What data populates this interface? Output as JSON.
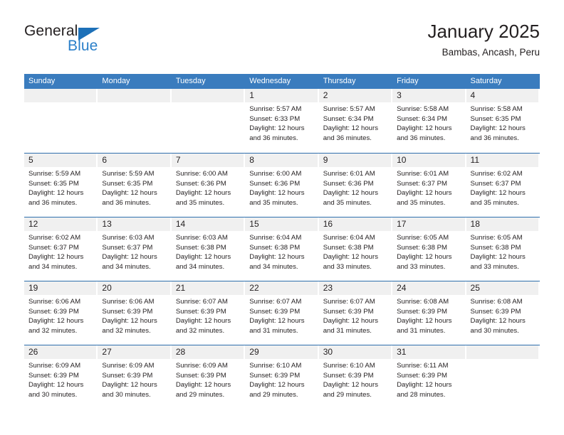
{
  "brand": {
    "name_part1": "General",
    "name_part2": "Blue",
    "triangle_color": "#1d70b8",
    "blue_color": "#2a7fc9"
  },
  "header": {
    "title": "January 2025",
    "subtitle": "Bambas, Ancash, Peru"
  },
  "theme": {
    "header_bar_color": "#3a7cbe",
    "week_divider_color": "#2f6fad",
    "day_number_band_color": "#f0f0f0",
    "text_color": "#231f20"
  },
  "calendar": {
    "weekdays": [
      "Sunday",
      "Monday",
      "Tuesday",
      "Wednesday",
      "Thursday",
      "Friday",
      "Saturday"
    ],
    "weeks": [
      [
        {
          "day": "",
          "lines": []
        },
        {
          "day": "",
          "lines": []
        },
        {
          "day": "",
          "lines": []
        },
        {
          "day": "1",
          "lines": [
            "Sunrise: 5:57 AM",
            "Sunset: 6:33 PM",
            "Daylight: 12 hours",
            "and 36 minutes."
          ]
        },
        {
          "day": "2",
          "lines": [
            "Sunrise: 5:57 AM",
            "Sunset: 6:34 PM",
            "Daylight: 12 hours",
            "and 36 minutes."
          ]
        },
        {
          "day": "3",
          "lines": [
            "Sunrise: 5:58 AM",
            "Sunset: 6:34 PM",
            "Daylight: 12 hours",
            "and 36 minutes."
          ]
        },
        {
          "day": "4",
          "lines": [
            "Sunrise: 5:58 AM",
            "Sunset: 6:35 PM",
            "Daylight: 12 hours",
            "and 36 minutes."
          ]
        }
      ],
      [
        {
          "day": "5",
          "lines": [
            "Sunrise: 5:59 AM",
            "Sunset: 6:35 PM",
            "Daylight: 12 hours",
            "and 36 minutes."
          ]
        },
        {
          "day": "6",
          "lines": [
            "Sunrise: 5:59 AM",
            "Sunset: 6:35 PM",
            "Daylight: 12 hours",
            "and 36 minutes."
          ]
        },
        {
          "day": "7",
          "lines": [
            "Sunrise: 6:00 AM",
            "Sunset: 6:36 PM",
            "Daylight: 12 hours",
            "and 35 minutes."
          ]
        },
        {
          "day": "8",
          "lines": [
            "Sunrise: 6:00 AM",
            "Sunset: 6:36 PM",
            "Daylight: 12 hours",
            "and 35 minutes."
          ]
        },
        {
          "day": "9",
          "lines": [
            "Sunrise: 6:01 AM",
            "Sunset: 6:36 PM",
            "Daylight: 12 hours",
            "and 35 minutes."
          ]
        },
        {
          "day": "10",
          "lines": [
            "Sunrise: 6:01 AM",
            "Sunset: 6:37 PM",
            "Daylight: 12 hours",
            "and 35 minutes."
          ]
        },
        {
          "day": "11",
          "lines": [
            "Sunrise: 6:02 AM",
            "Sunset: 6:37 PM",
            "Daylight: 12 hours",
            "and 35 minutes."
          ]
        }
      ],
      [
        {
          "day": "12",
          "lines": [
            "Sunrise: 6:02 AM",
            "Sunset: 6:37 PM",
            "Daylight: 12 hours",
            "and 34 minutes."
          ]
        },
        {
          "day": "13",
          "lines": [
            "Sunrise: 6:03 AM",
            "Sunset: 6:37 PM",
            "Daylight: 12 hours",
            "and 34 minutes."
          ]
        },
        {
          "day": "14",
          "lines": [
            "Sunrise: 6:03 AM",
            "Sunset: 6:38 PM",
            "Daylight: 12 hours",
            "and 34 minutes."
          ]
        },
        {
          "day": "15",
          "lines": [
            "Sunrise: 6:04 AM",
            "Sunset: 6:38 PM",
            "Daylight: 12 hours",
            "and 34 minutes."
          ]
        },
        {
          "day": "16",
          "lines": [
            "Sunrise: 6:04 AM",
            "Sunset: 6:38 PM",
            "Daylight: 12 hours",
            "and 33 minutes."
          ]
        },
        {
          "day": "17",
          "lines": [
            "Sunrise: 6:05 AM",
            "Sunset: 6:38 PM",
            "Daylight: 12 hours",
            "and 33 minutes."
          ]
        },
        {
          "day": "18",
          "lines": [
            "Sunrise: 6:05 AM",
            "Sunset: 6:38 PM",
            "Daylight: 12 hours",
            "and 33 minutes."
          ]
        }
      ],
      [
        {
          "day": "19",
          "lines": [
            "Sunrise: 6:06 AM",
            "Sunset: 6:39 PM",
            "Daylight: 12 hours",
            "and 32 minutes."
          ]
        },
        {
          "day": "20",
          "lines": [
            "Sunrise: 6:06 AM",
            "Sunset: 6:39 PM",
            "Daylight: 12 hours",
            "and 32 minutes."
          ]
        },
        {
          "day": "21",
          "lines": [
            "Sunrise: 6:07 AM",
            "Sunset: 6:39 PM",
            "Daylight: 12 hours",
            "and 32 minutes."
          ]
        },
        {
          "day": "22",
          "lines": [
            "Sunrise: 6:07 AM",
            "Sunset: 6:39 PM",
            "Daylight: 12 hours",
            "and 31 minutes."
          ]
        },
        {
          "day": "23",
          "lines": [
            "Sunrise: 6:07 AM",
            "Sunset: 6:39 PM",
            "Daylight: 12 hours",
            "and 31 minutes."
          ]
        },
        {
          "day": "24",
          "lines": [
            "Sunrise: 6:08 AM",
            "Sunset: 6:39 PM",
            "Daylight: 12 hours",
            "and 31 minutes."
          ]
        },
        {
          "day": "25",
          "lines": [
            "Sunrise: 6:08 AM",
            "Sunset: 6:39 PM",
            "Daylight: 12 hours",
            "and 30 minutes."
          ]
        }
      ],
      [
        {
          "day": "26",
          "lines": [
            "Sunrise: 6:09 AM",
            "Sunset: 6:39 PM",
            "Daylight: 12 hours",
            "and 30 minutes."
          ]
        },
        {
          "day": "27",
          "lines": [
            "Sunrise: 6:09 AM",
            "Sunset: 6:39 PM",
            "Daylight: 12 hours",
            "and 30 minutes."
          ]
        },
        {
          "day": "28",
          "lines": [
            "Sunrise: 6:09 AM",
            "Sunset: 6:39 PM",
            "Daylight: 12 hours",
            "and 29 minutes."
          ]
        },
        {
          "day": "29",
          "lines": [
            "Sunrise: 6:10 AM",
            "Sunset: 6:39 PM",
            "Daylight: 12 hours",
            "and 29 minutes."
          ]
        },
        {
          "day": "30",
          "lines": [
            "Sunrise: 6:10 AM",
            "Sunset: 6:39 PM",
            "Daylight: 12 hours",
            "and 29 minutes."
          ]
        },
        {
          "day": "31",
          "lines": [
            "Sunrise: 6:11 AM",
            "Sunset: 6:39 PM",
            "Daylight: 12 hours",
            "and 28 minutes."
          ]
        },
        {
          "day": "",
          "lines": []
        }
      ]
    ]
  }
}
